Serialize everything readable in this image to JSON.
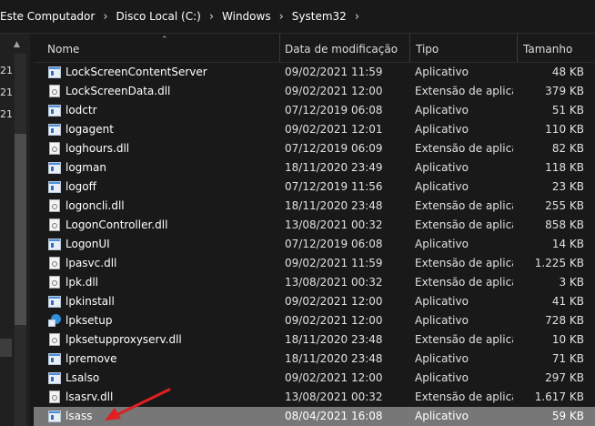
{
  "breadcrumb": [
    "Este Computador",
    "Disco Local (C:)",
    "Windows",
    "System32"
  ],
  "nav_labels": [
    "21",
    "21",
    "21"
  ],
  "columns": {
    "name": "Nome",
    "date": "Data de modificação",
    "type": "Tipo",
    "size": "Tamanho"
  },
  "files": [
    {
      "name": "LockScreenContentServer",
      "date": "09/02/2021 11:59",
      "type": "Aplicativo",
      "size": "48 KB",
      "icon": "application-icon"
    },
    {
      "name": "LockScreenData.dll",
      "date": "09/02/2021 12:00",
      "type": "Extensão de aplica...",
      "size": "379 KB",
      "icon": "dll-file-icon"
    },
    {
      "name": "lodctr",
      "date": "07/12/2019 06:08",
      "type": "Aplicativo",
      "size": "51 KB",
      "icon": "application-icon"
    },
    {
      "name": "logagent",
      "date": "09/02/2021 12:01",
      "type": "Aplicativo",
      "size": "110 KB",
      "icon": "application-icon"
    },
    {
      "name": "loghours.dll",
      "date": "07/12/2019 06:09",
      "type": "Extensão de aplica...",
      "size": "82 KB",
      "icon": "dll-file-icon"
    },
    {
      "name": "logman",
      "date": "18/11/2020 23:49",
      "type": "Aplicativo",
      "size": "118 KB",
      "icon": "application-icon"
    },
    {
      "name": "logoff",
      "date": "07/12/2019 11:56",
      "type": "Aplicativo",
      "size": "23 KB",
      "icon": "application-icon"
    },
    {
      "name": "logoncli.dll",
      "date": "18/11/2020 23:48",
      "type": "Extensão de aplica...",
      "size": "255 KB",
      "icon": "dll-file-icon"
    },
    {
      "name": "LogonController.dll",
      "date": "13/08/2021 00:32",
      "type": "Extensão de aplica...",
      "size": "858 KB",
      "icon": "dll-file-icon"
    },
    {
      "name": "LogonUI",
      "date": "07/12/2019 06:08",
      "type": "Aplicativo",
      "size": "14 KB",
      "icon": "application-icon"
    },
    {
      "name": "lpasvc.dll",
      "date": "09/02/2021 11:59",
      "type": "Extensão de aplica...",
      "size": "1.225 KB",
      "icon": "dll-file-icon"
    },
    {
      "name": "lpk.dll",
      "date": "13/08/2021 00:32",
      "type": "Extensão de aplica...",
      "size": "3 KB",
      "icon": "dll-file-icon"
    },
    {
      "name": "lpkinstall",
      "date": "09/02/2021 12:00",
      "type": "Aplicativo",
      "size": "41 KB",
      "icon": "application-icon"
    },
    {
      "name": "lpksetup",
      "date": "09/02/2021 12:00",
      "type": "Aplicativo",
      "size": "728 KB",
      "icon": "globe-setup-icon"
    },
    {
      "name": "lpksetupproxyserv.dll",
      "date": "18/11/2020 23:48",
      "type": "Extensão de aplica...",
      "size": "10 KB",
      "icon": "dll-file-icon"
    },
    {
      "name": "lpremove",
      "date": "18/11/2020 23:48",
      "type": "Aplicativo",
      "size": "71 KB",
      "icon": "application-icon"
    },
    {
      "name": "Lsalso",
      "date": "09/02/2021 12:00",
      "type": "Aplicativo",
      "size": "297 KB",
      "icon": "application-icon"
    },
    {
      "name": "lsasrv.dll",
      "date": "13/08/2021 00:32",
      "type": "Extensão de aplica...",
      "size": "1.617 KB",
      "icon": "dll-file-icon"
    },
    {
      "name": "lsass",
      "date": "08/04/2021 16:08",
      "type": "Aplicativo",
      "size": "59 KB",
      "icon": "application-icon",
      "selected": true
    }
  ],
  "colors": {
    "background": "#191919",
    "selected_row": "#777777",
    "annotation_arrow": "#e02020"
  }
}
